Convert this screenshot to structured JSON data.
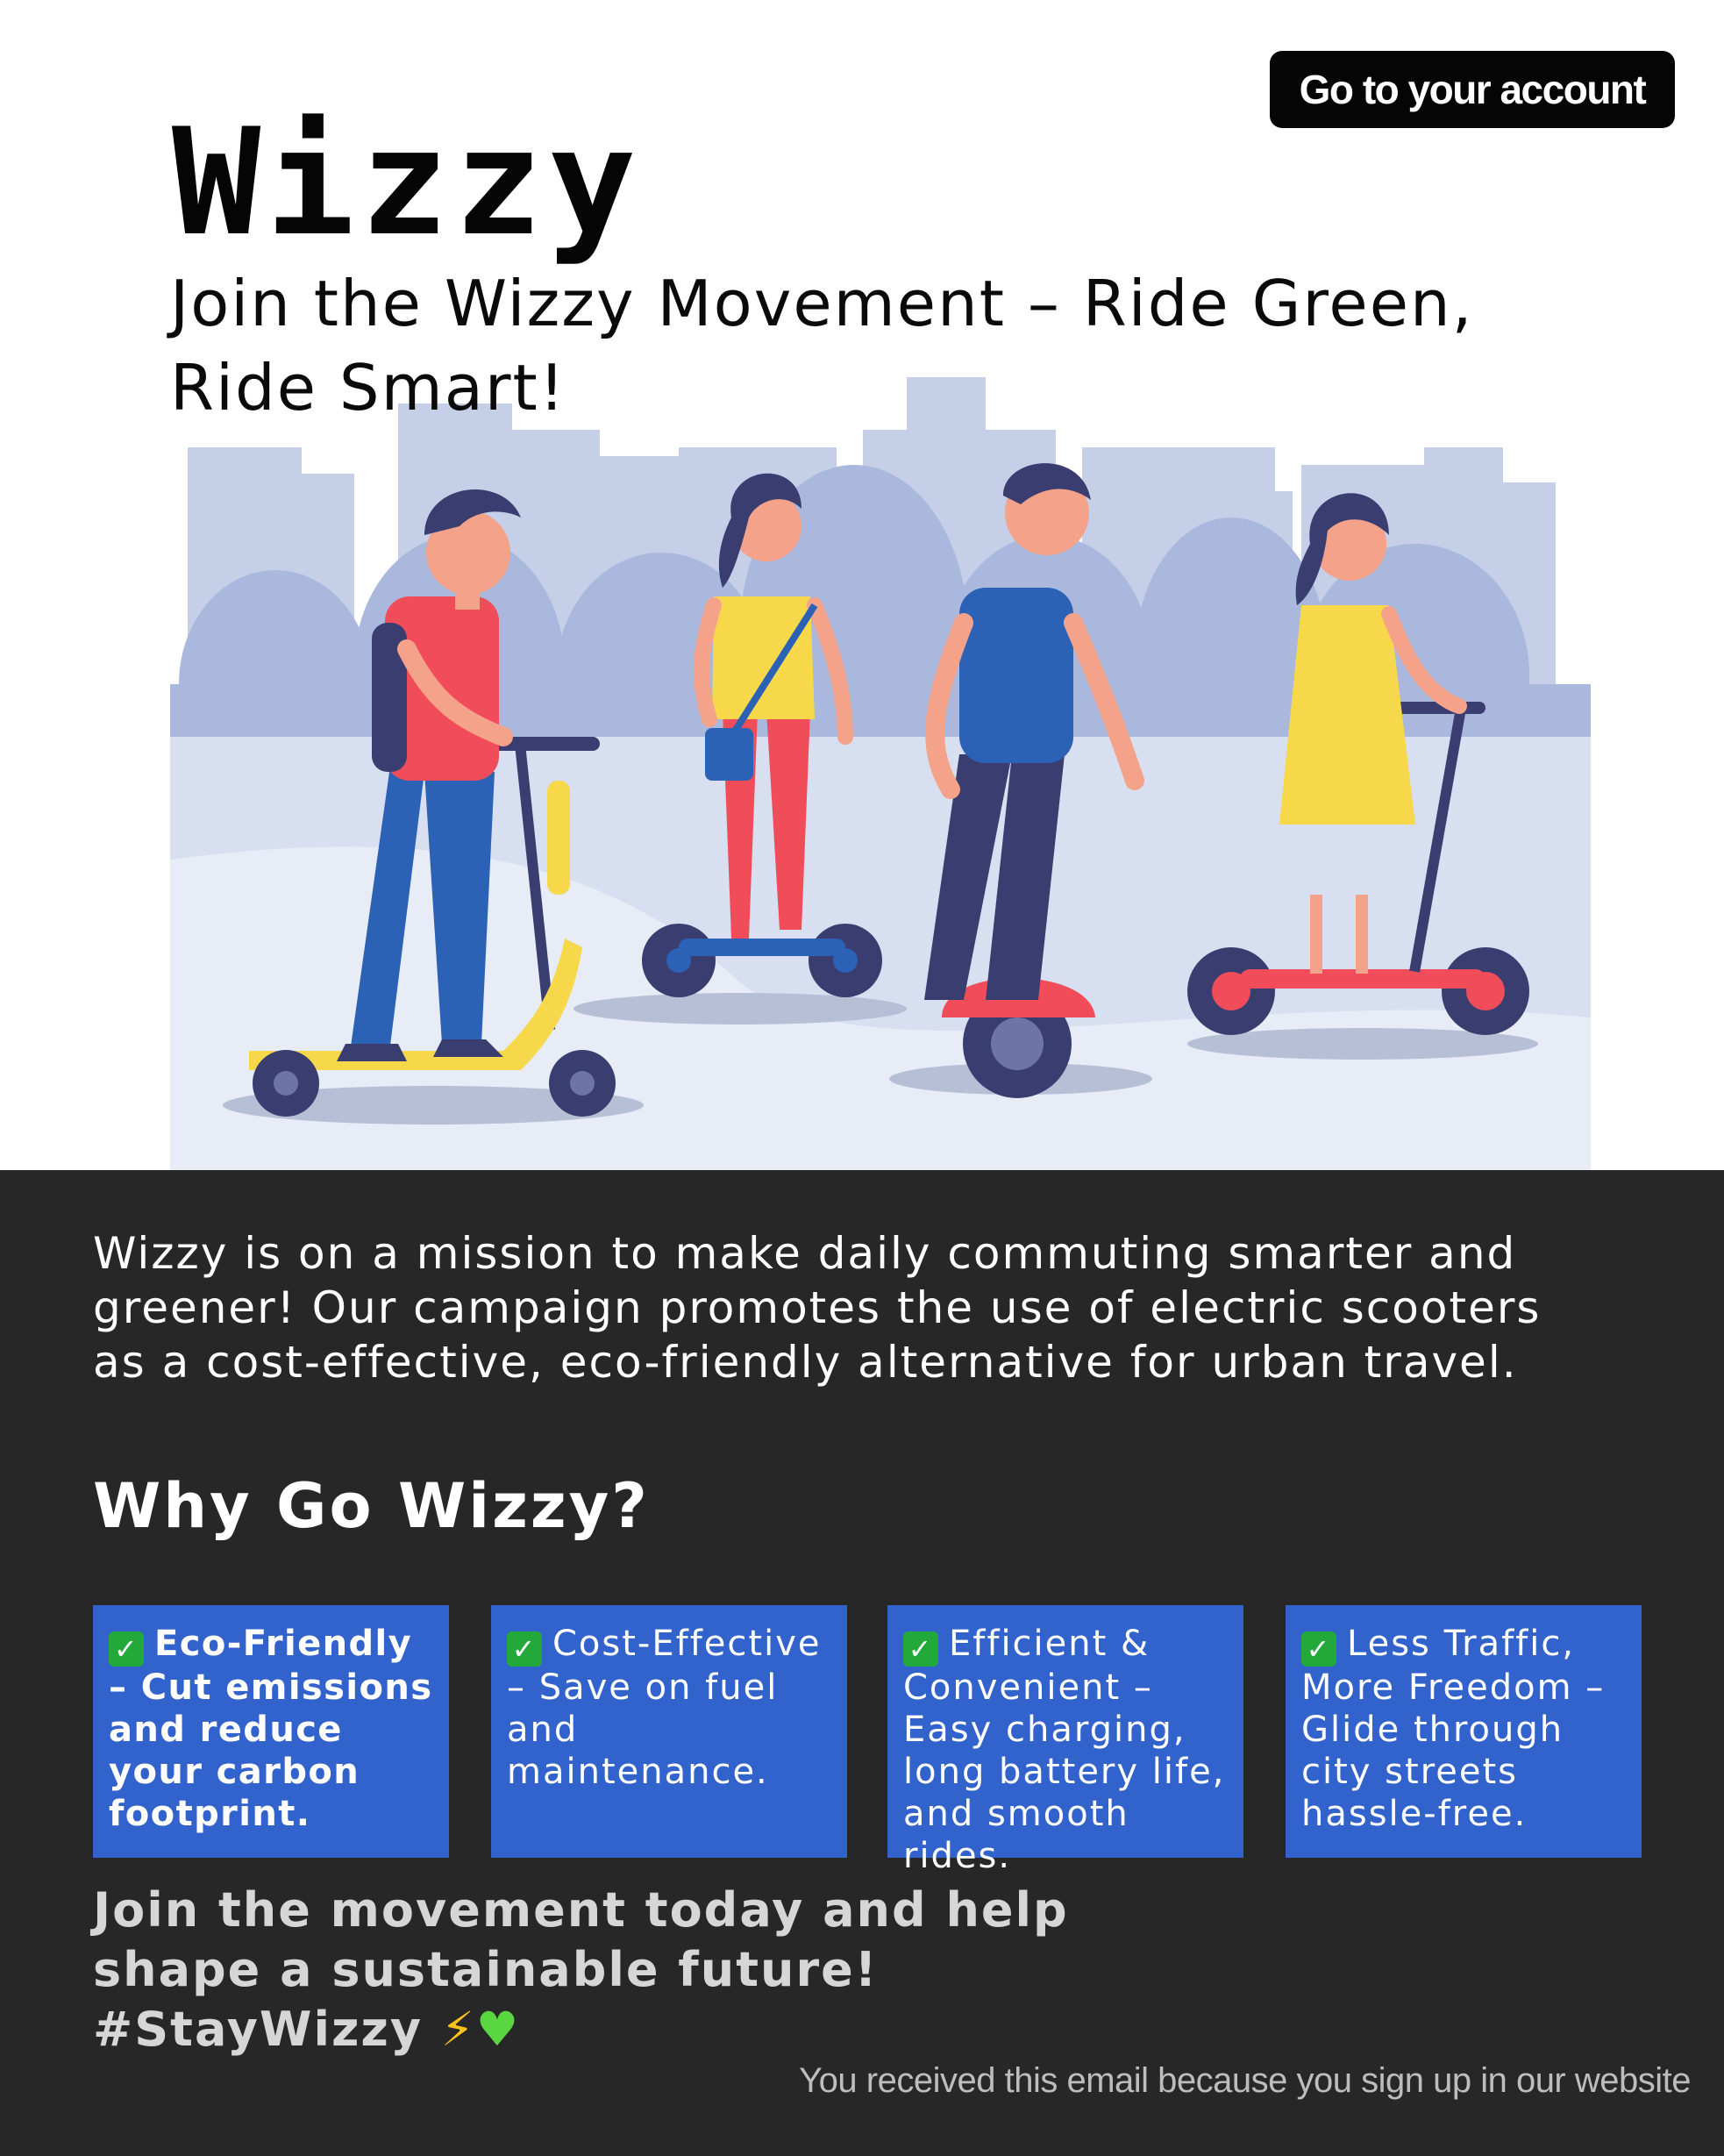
{
  "header": {
    "account_button": "Go to your account",
    "logo": "Wizzy",
    "headline_line1": "Join the Wizzy Movement – Ride Green,",
    "headline_line2": "Ride Smart!"
  },
  "hero": {
    "illustration": "people-riding-electric-scooters-in-city"
  },
  "main": {
    "intro": "Wizzy is on a mission to make daily commuting smarter and greener! Our campaign promotes the use of electric scooters as a cost-effective, eco-friendly alternative for urban travel.",
    "why_title": "Why Go Wizzy?",
    "cards": [
      {
        "icon": "check-mark-icon",
        "text": "Eco-Friendly – Cut emissions and reduce your carbon footprint."
      },
      {
        "icon": "check-mark-icon",
        "text": "Cost-Effective – Save on fuel and maintenance."
      },
      {
        "icon": "check-mark-icon",
        "text": "Efficient & Convenient – Easy charging, long battery life, and smooth rides."
      },
      {
        "icon": "check-mark-icon",
        "text": "Less Traffic, More Freedom – Glide through city streets hassle-free."
      }
    ],
    "cta_line1": "Join the movement today and help",
    "cta_line2": "shape a sustainable future!",
    "cta_line3": "#StayWizzy",
    "footer_note": "You received this email because you sign up in our website"
  },
  "colors": {
    "dark_background": "#272727",
    "card_blue": "#3263cc",
    "button_black": "#050505"
  }
}
